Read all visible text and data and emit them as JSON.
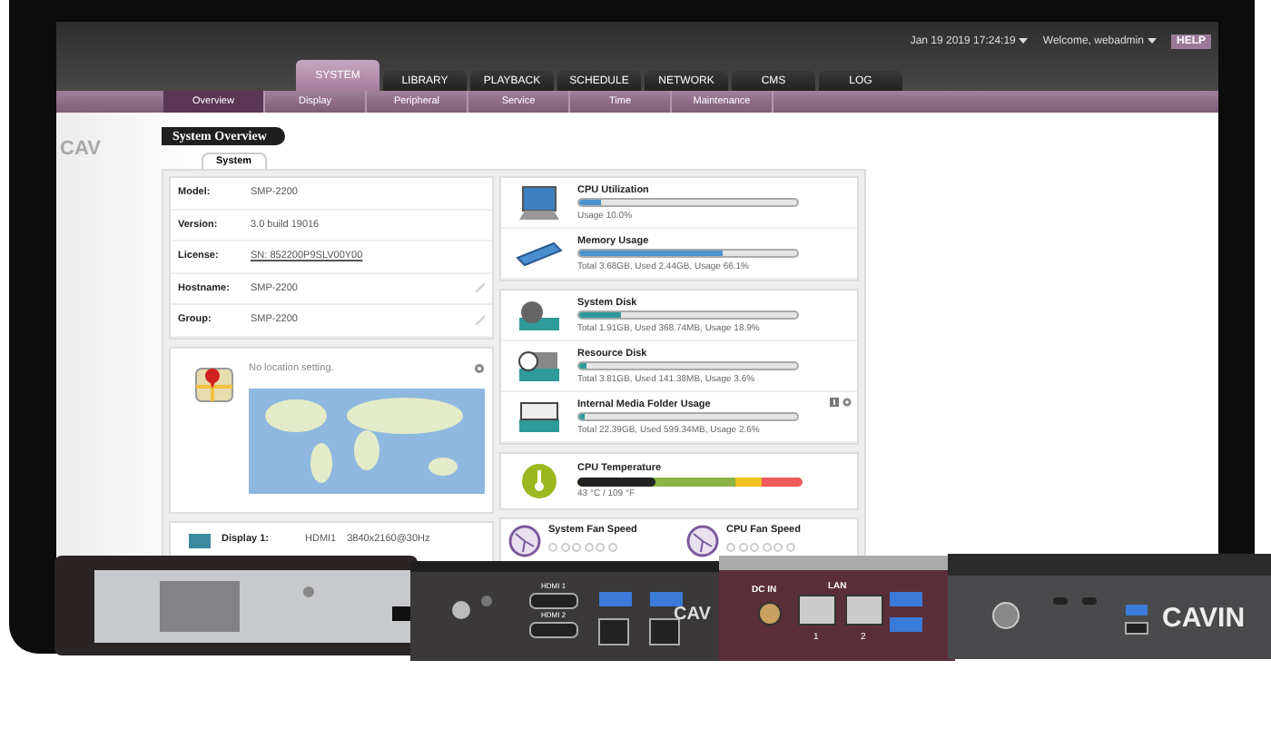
{
  "header": {
    "datetime": "Jan 19 2019 17:24:19",
    "user": "Welcome, webadmin",
    "help": "HELP"
  },
  "tabs": [
    {
      "label": "SYSTEM",
      "selected": true
    },
    {
      "label": "LIBRARY",
      "selected": false
    },
    {
      "label": "PLAYBACK",
      "selected": false
    },
    {
      "label": "SCHEDULE",
      "selected": false
    },
    {
      "label": "NETWORK",
      "selected": false
    },
    {
      "label": "CMS",
      "selected": false
    },
    {
      "label": "LOG",
      "selected": false
    }
  ],
  "subtabs": [
    {
      "label": "Overview",
      "selected": true
    },
    {
      "label": "Display",
      "selected": false
    },
    {
      "label": "Peripheral",
      "selected": false
    },
    {
      "label": "Service",
      "selected": false
    },
    {
      "label": "Time",
      "selected": false
    },
    {
      "label": "Maintenance",
      "selected": false
    }
  ],
  "brand_text": "CAV",
  "page_title": "System Overview",
  "panel_tab": "System",
  "info": [
    {
      "label": "Model:",
      "value": "SMP-2200",
      "kind": "text"
    },
    {
      "label": "Version:",
      "value": "3.0 build 19016",
      "kind": "text"
    },
    {
      "label": "License:",
      "value": "SN: 852200P9SLV00Y00",
      "kind": "link"
    },
    {
      "label": "Hostname:",
      "value": "SMP-2200",
      "kind": "editable"
    },
    {
      "label": "Group:",
      "value": "SMP-2200",
      "kind": "editable"
    }
  ],
  "location": {
    "message": "No location setting."
  },
  "display": {
    "label": "Display 1:",
    "value": "HDMI1",
    "resolution": "3840x2160@30Hz"
  },
  "resource_groups": [
    [
      {
        "kind": "cpu",
        "title": "CPU Utilization",
        "level": 0.1,
        "reading": "Usage 10.0%"
      },
      {
        "kind": "memory",
        "title": "Memory Usage",
        "level": 0.661,
        "reading": "Total 3.68GB, Used 2.44GB, Usage 66.1%"
      }
    ],
    [
      {
        "kind": "system-disk",
        "title": "System Disk",
        "level": 0.189,
        "reading": "Total 1.91GB, Used 368.74MB, Usage 18.9%"
      },
      {
        "kind": "resource-disk",
        "title": "Resource Disk",
        "level": 0.036,
        "reading": "Total 3.81GB, Used 141.38MB, Usage 3.6%"
      },
      {
        "kind": "media-disk",
        "title": "Internal Media Folder Usage",
        "level": 0.026,
        "reading": "Total 22.39GB, Used 599.34MB, Usage 2.6%"
      }
    ]
  ],
  "temperature": {
    "title": "CPU Temperature",
    "level": 0.35,
    "reading": "43 °C / 109 °F"
  },
  "fans": [
    {
      "title": "System Fan Speed"
    },
    {
      "title": "CPU Fan Speed"
    }
  ],
  "devices": {
    "port_labels": [
      "HDMI 1",
      "HDMI 2"
    ],
    "partial_logo": "CAV",
    "power_label": "DC IN",
    "lan_label": "LAN",
    "lan_ports": [
      "1",
      "2"
    ],
    "logo": "CAVIN"
  }
}
